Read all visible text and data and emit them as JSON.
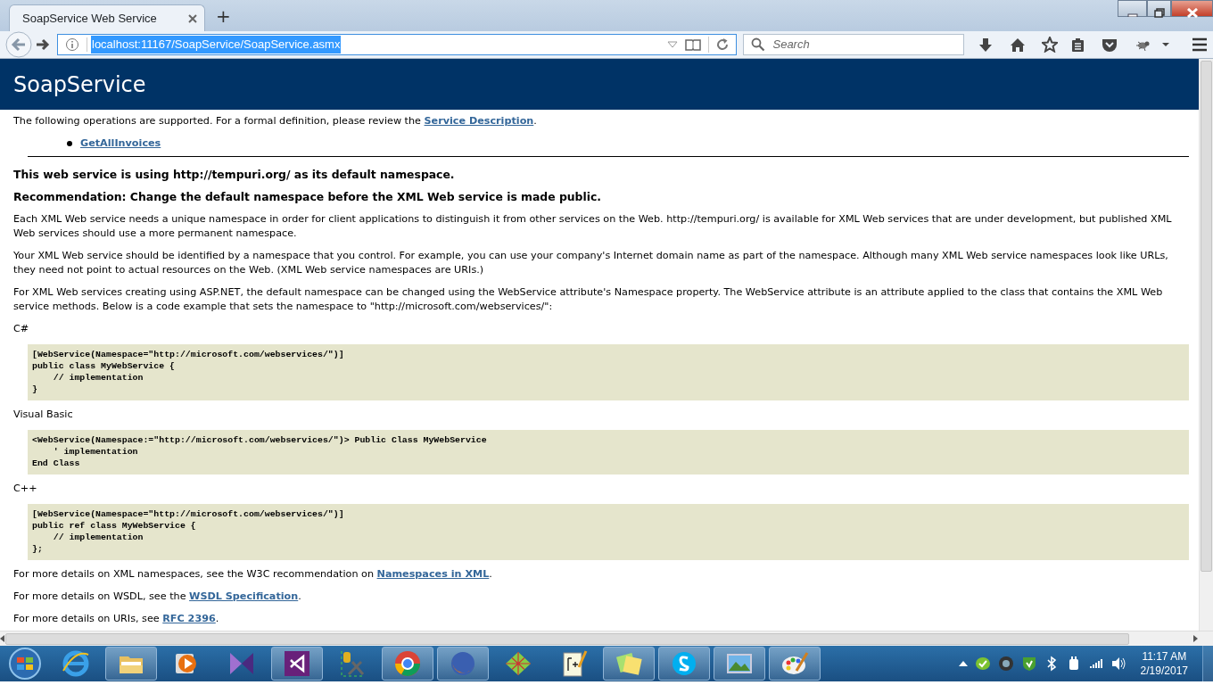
{
  "browser": {
    "tab": {
      "title": "SoapService Web Service",
      "selected": true
    },
    "new_tab": "+",
    "url": {
      "value": "localhost:11167/SoapService/SoapService.asmx",
      "selected": true
    },
    "search": {
      "placeholder": "Search"
    }
  },
  "page": {
    "heading": "SoapService",
    "sections": [
      {
        "kind": "paragraph",
        "text": "The following operations are supported. For a formal definition, please review the ",
        "link": "Service Description",
        "after": "."
      },
      {
        "kind": "operations",
        "items": [
          "GetAllInvoices"
        ]
      },
      {
        "kind": "rule"
      },
      {
        "kind": "note",
        "text": "This web service is using http://tempuri.org/ as its default namespace."
      },
      {
        "kind": "note",
        "text": "Recommendation: Change the default namespace before the XML Web service is made public."
      },
      {
        "kind": "paragraph",
        "text": "Each XML Web service needs a unique namespace in order for client applications to distinguish it from other services on the Web. http://tempuri.org/ is available for XML Web services that are under development, but published XML Web services should use a more permanent namespace."
      },
      {
        "kind": "paragraph",
        "text": "Your XML Web service should be identified by a namespace that you control. For example, you can use your company's Internet domain name as part of the namespace. Although many XML Web service namespaces look like URLs, they need not point to actual resources on the Web. (XML Web service namespaces are URIs.)"
      },
      {
        "kind": "paragraph",
        "text": "For XML Web services creating using ASP.NET, the default namespace can be changed using the WebService attribute's Namespace property. The WebService attribute is an attribute applied to the class that contains the XML Web service methods. Below is a code example that sets the namespace to \"http://microsoft.com/webservices/\":"
      },
      {
        "kind": "label",
        "text": "C#"
      },
      {
        "kind": "code",
        "lines": [
          "[WebService(Namespace=\"http://microsoft.com/webservices/\")]",
          "public class MyWebService {",
          "    // implementation",
          "}"
        ]
      },
      {
        "kind": "label",
        "text": "Visual Basic"
      },
      {
        "kind": "code",
        "lines": [
          "<WebService(Namespace:=\"http://microsoft.com/webservices/\")> Public Class MyWebService",
          "    ' implementation",
          "End Class"
        ]
      },
      {
        "kind": "label",
        "text": "C++"
      },
      {
        "kind": "code",
        "lines": [
          "[WebService(Namespace=\"http://microsoft.com/webservices/\")]",
          "public ref class MyWebService {",
          "    // implementation",
          "};"
        ]
      },
      {
        "kind": "paragraph",
        "text": "For more details on XML namespaces, see the W3C recommendation on ",
        "link": "Namespaces in XML",
        "after": "."
      },
      {
        "kind": "paragraph",
        "text": "For more details on WSDL, see the ",
        "link": "WSDL Specification",
        "after": "."
      },
      {
        "kind": "paragraph",
        "text": "For more details on URIs, see ",
        "link": "RFC 2396",
        "after": "."
      }
    ]
  },
  "taskbar": {
    "apps": [
      {
        "running": false
      },
      {
        "running": true
      },
      {
        "running": false
      },
      {
        "running": false
      },
      {
        "running": true
      },
      {
        "running": false
      },
      {
        "running": true
      },
      {
        "running": true
      },
      {
        "running": false
      },
      {
        "running": false
      },
      {
        "running": true
      },
      {
        "running": true
      },
      {
        "running": true
      },
      {
        "running": true
      }
    ],
    "time": "11:17 AM",
    "date": "2/19/2017"
  }
}
